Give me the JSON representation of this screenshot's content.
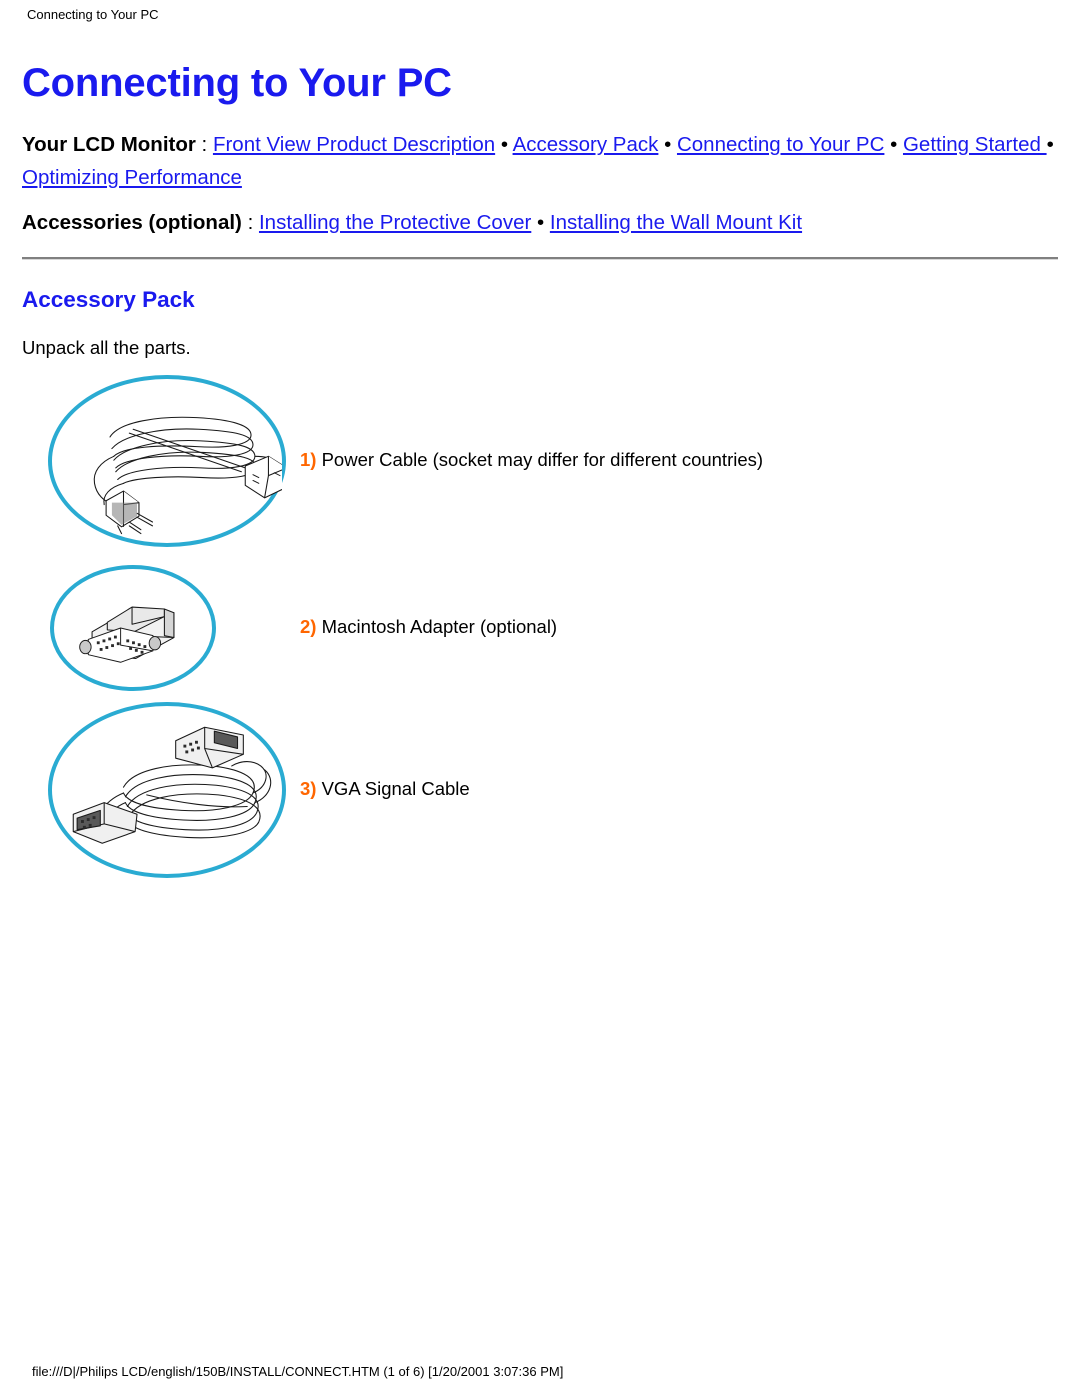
{
  "header": {
    "running_title": "Connecting to Your PC"
  },
  "page_title": "Connecting to Your PC",
  "nav": {
    "line1_lead": "Your LCD Monitor",
    "line1_colon": " : ",
    "line2_lead": "Accessories (optional)",
    "line2_colon": " : ",
    "bullet": " • ",
    "monitor_links": [
      "Front View Product Description",
      "Accessory Pack",
      "Connecting to Your PC",
      "Getting Started ",
      "Optimizing Performance"
    ],
    "accessory_links": [
      "Installing the Protective Cover",
      "Installing the Wall Mount Kit"
    ]
  },
  "section": {
    "title": "Accessory Pack",
    "intro": "Unpack all the parts."
  },
  "accessories": [
    {
      "number": "1)",
      "label": " Power Cable (socket may differ for different countries)",
      "icon": "power-cable-illustration"
    },
    {
      "number": "2)",
      "label": " Macintosh Adapter (optional)",
      "icon": "macintosh-adapter-illustration"
    },
    {
      "number": "3)",
      "label": " VGA Signal Cable",
      "icon": "vga-signal-cable-illustration"
    }
  ],
  "footer": {
    "path_line": "file:///D|/Philips LCD/english/150B/INSTALL/CONNECT.HTM (1 of 6) [1/20/2001 3:07:36 PM]"
  },
  "colors": {
    "link_blue": "#1a1aee",
    "heading_blue": "#1a1aee",
    "circle_cyan": "#2aabd2",
    "number_orange": "#ff6600",
    "rule_gray": "#808080",
    "text_black": "#000000",
    "background": "#ffffff"
  }
}
